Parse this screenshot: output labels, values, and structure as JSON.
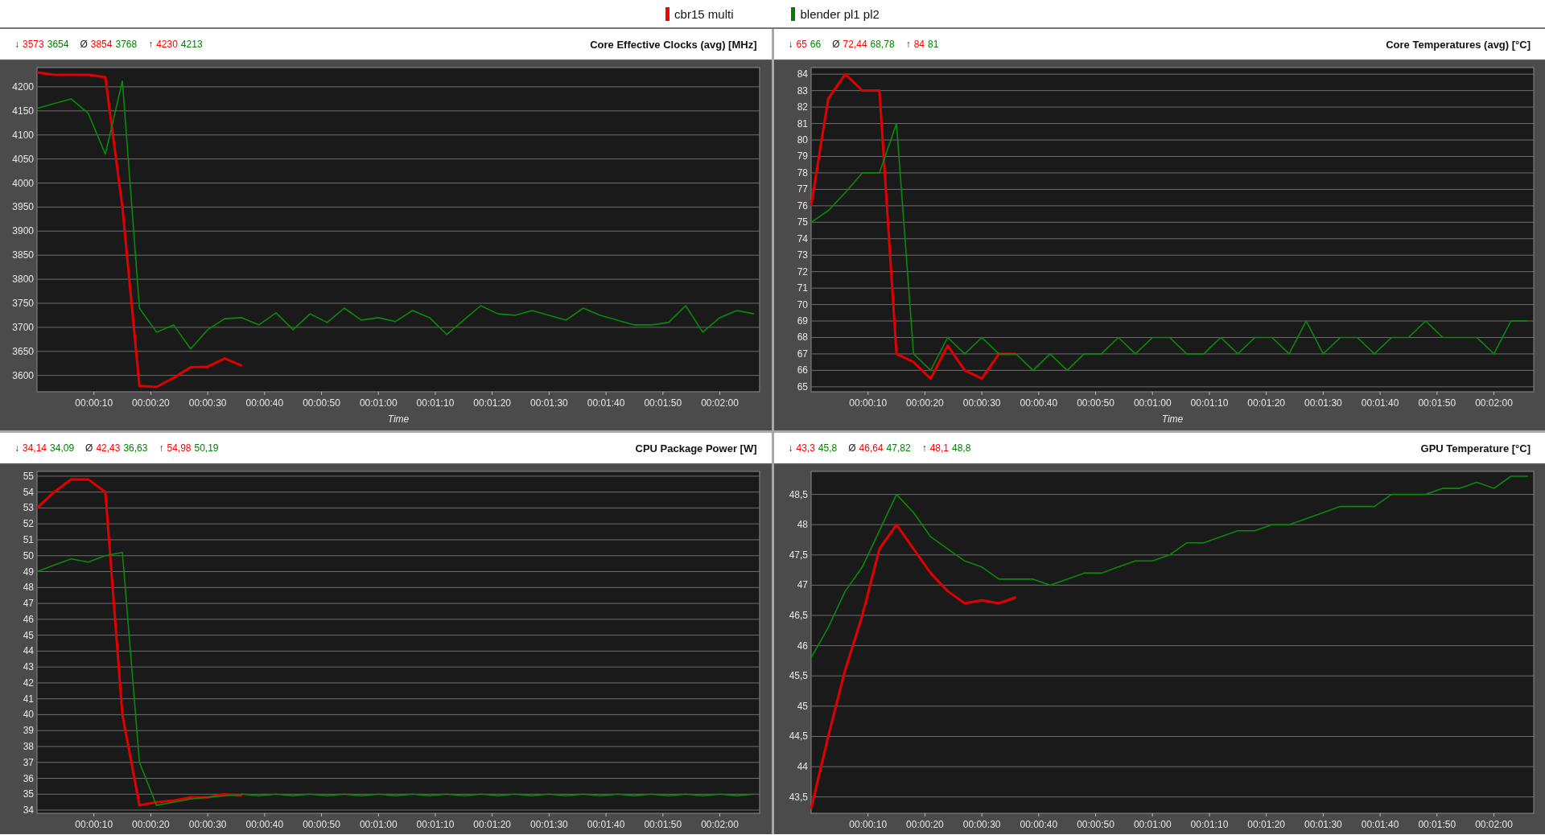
{
  "legend": [
    {
      "name": "cbr15 multi",
      "color": "#ff0000"
    },
    {
      "name": "blender pl1 pl2",
      "color": "#008000"
    }
  ],
  "panels": [
    {
      "stats": [
        {
          "symbol": "↓",
          "values": [
            "3573",
            "3654"
          ]
        },
        {
          "symbol": "Ø",
          "values": [
            "3854",
            "3768"
          ]
        },
        {
          "symbol": "↑",
          "values": [
            "4230",
            "4213"
          ]
        }
      ],
      "chart_data": {
        "type": "line",
        "title": "Core Effective Clocks (avg) [MHz]",
        "xlabel": "Time",
        "x": [
          0,
          3,
          6,
          9,
          12,
          15,
          18,
          21,
          24,
          27,
          30,
          33,
          36,
          39,
          42,
          45,
          48,
          51,
          54,
          57,
          60,
          63,
          66,
          69,
          72,
          75,
          78,
          81,
          84,
          87,
          90,
          93,
          96,
          99,
          102,
          105,
          108,
          111,
          114,
          117,
          120,
          123,
          126
        ],
        "xlim": [
          0,
          127
        ],
        "ylim": [
          3566,
          4240
        ],
        "xticks": [
          {
            "value": 10,
            "label": "00:00:10"
          },
          {
            "value": 20,
            "label": "00:00:20"
          },
          {
            "value": 30,
            "label": "00:00:30"
          },
          {
            "value": 40,
            "label": "00:00:40"
          },
          {
            "value": 50,
            "label": "00:00:50"
          },
          {
            "value": 60,
            "label": "00:01:00"
          },
          {
            "value": 70,
            "label": "00:01:10"
          },
          {
            "value": 80,
            "label": "00:01:20"
          },
          {
            "value": 90,
            "label": "00:01:30"
          },
          {
            "value": 100,
            "label": "00:01:40"
          },
          {
            "value": 110,
            "label": "00:01:50"
          },
          {
            "value": 120,
            "label": "00:02:00"
          }
        ],
        "yticks": [
          3600,
          3650,
          3700,
          3750,
          3800,
          3850,
          3900,
          3950,
          4000,
          4050,
          4100,
          4150,
          4200
        ],
        "grid": true,
        "series": [
          {
            "color": "#e00000",
            "values": [
              4230,
              4225,
              4225,
              4225,
              4220,
              3950,
              3578,
              3576,
              3595,
              3617,
              3618,
              3635,
              3620,
              null,
              null,
              null,
              null,
              null,
              null,
              null,
              null,
              null,
              null,
              null,
              null,
              null,
              null,
              null,
              null,
              null,
              null,
              null,
              null,
              null,
              null,
              null,
              null,
              null,
              null,
              null,
              null,
              null,
              null
            ]
          },
          {
            "color": "#0a8a0a",
            "values": [
              4155,
              4165,
              4175,
              4145,
              4060,
              4212,
              3740,
              3690,
              3705,
              3655,
              3695,
              3718,
              3720,
              3705,
              3730,
              3695,
              3728,
              3710,
              3740,
              3715,
              3720,
              3712,
              3735,
              3720,
              3685,
              3715,
              3745,
              3728,
              3725,
              3735,
              3725,
              3715,
              3740,
              3725,
              3715,
              3705,
              3705,
              3710,
              3745,
              3690,
              3720,
              3735,
              3728
            ]
          }
        ]
      }
    },
    {
      "stats": [
        {
          "symbol": "↓",
          "values": [
            "65",
            "66"
          ]
        },
        {
          "symbol": "Ø",
          "values": [
            "72,44",
            "68,78"
          ]
        },
        {
          "symbol": "↑",
          "values": [
            "84",
            "81"
          ]
        }
      ],
      "chart_data": {
        "type": "line",
        "title": "Core Temperatures (avg) [°C]",
        "xlabel": "Time",
        "x": [
          0,
          3,
          6,
          9,
          12,
          15,
          18,
          21,
          24,
          27,
          30,
          33,
          36,
          39,
          42,
          45,
          48,
          51,
          54,
          57,
          60,
          63,
          66,
          69,
          72,
          75,
          78,
          81,
          84,
          87,
          90,
          93,
          96,
          99,
          102,
          105,
          108,
          111,
          114,
          117,
          120,
          123,
          126
        ],
        "xlim": [
          0,
          127
        ],
        "ylim": [
          64.7,
          84.4
        ],
        "xticks": [
          {
            "value": 10,
            "label": "00:00:10"
          },
          {
            "value": 20,
            "label": "00:00:20"
          },
          {
            "value": 30,
            "label": "00:00:30"
          },
          {
            "value": 40,
            "label": "00:00:40"
          },
          {
            "value": 50,
            "label": "00:00:50"
          },
          {
            "value": 60,
            "label": "00:01:00"
          },
          {
            "value": 70,
            "label": "00:01:10"
          },
          {
            "value": 80,
            "label": "00:01:20"
          },
          {
            "value": 90,
            "label": "00:01:30"
          },
          {
            "value": 100,
            "label": "00:01:40"
          },
          {
            "value": 110,
            "label": "00:01:50"
          },
          {
            "value": 120,
            "label": "00:02:00"
          }
        ],
        "yticks": [
          65,
          66,
          67,
          68,
          69,
          70,
          71,
          72,
          73,
          74,
          75,
          76,
          77,
          78,
          79,
          80,
          81,
          82,
          83,
          84
        ],
        "grid": true,
        "series": [
          {
            "color": "#e00000",
            "values": [
              76,
              82.5,
              84,
              83,
              83,
              67,
              66.5,
              65.5,
              67.5,
              66,
              65.5,
              67,
              67,
              null,
              null,
              null,
              null,
              null,
              null,
              null,
              null,
              null,
              null,
              null,
              null,
              null,
              null,
              null,
              null,
              null,
              null,
              null,
              null,
              null,
              null,
              null,
              null,
              null,
              null,
              null,
              null,
              null,
              null
            ]
          },
          {
            "color": "#0a8a0a",
            "values": [
              75,
              75.7,
              76.8,
              78,
              78,
              81,
              67,
              66,
              68,
              67,
              68,
              67,
              67,
              66,
              67,
              66,
              67,
              67,
              68,
              67,
              68,
              68,
              67,
              67,
              68,
              67,
              68,
              68,
              67,
              69,
              67,
              68,
              68,
              67,
              68,
              68,
              69,
              68,
              68,
              68,
              67,
              69,
              69
            ]
          }
        ]
      }
    },
    {
      "stats": [
        {
          "symbol": "↓",
          "values": [
            "34,14",
            "34,09"
          ]
        },
        {
          "symbol": "Ø",
          "values": [
            "42,43",
            "36,63"
          ]
        },
        {
          "symbol": "↑",
          "values": [
            "54,98",
            "50,19"
          ]
        }
      ],
      "chart_data": {
        "type": "line",
        "title": "CPU Package Power [W]",
        "x": [
          0,
          3,
          6,
          9,
          12,
          15,
          18,
          21,
          24,
          27,
          30,
          33,
          36,
          39,
          42,
          45,
          48,
          51,
          54,
          57,
          60,
          63,
          66,
          69,
          72,
          75,
          78,
          81,
          84,
          87,
          90,
          93,
          96,
          99,
          102,
          105,
          108,
          111,
          114,
          117,
          120,
          123,
          126
        ],
        "xlim": [
          0,
          127
        ],
        "ylim": [
          33.8,
          55.3
        ],
        "xticks": [
          {
            "value": 10,
            "label": "00:00:10"
          },
          {
            "value": 20,
            "label": "00:00:20"
          },
          {
            "value": 30,
            "label": "00:00:30"
          },
          {
            "value": 40,
            "label": "00:00:40"
          },
          {
            "value": 50,
            "label": "00:00:50"
          },
          {
            "value": 60,
            "label": "00:01:00"
          },
          {
            "value": 70,
            "label": "00:01:10"
          },
          {
            "value": 80,
            "label": "00:01:20"
          },
          {
            "value": 90,
            "label": "00:01:30"
          },
          {
            "value": 100,
            "label": "00:01:40"
          },
          {
            "value": 110,
            "label": "00:01:50"
          },
          {
            "value": 120,
            "label": "00:02:00"
          }
        ],
        "yticks": [
          34,
          35,
          36,
          37,
          38,
          39,
          40,
          41,
          42,
          43,
          44,
          45,
          46,
          47,
          48,
          49,
          50,
          51,
          52,
          53,
          54,
          55
        ],
        "grid": true,
        "series": [
          {
            "color": "#e00000",
            "values": [
              53,
              54,
              54.8,
              54.8,
              54,
              40,
              34.3,
              34.5,
              34.6,
              34.8,
              34.8,
              35,
              34.9,
              null,
              null,
              null,
              null,
              null,
              null,
              null,
              null,
              null,
              null,
              null,
              null,
              null,
              null,
              null,
              null,
              null,
              null,
              null,
              null,
              null,
              null,
              null,
              null,
              null,
              null,
              null,
              null,
              null,
              null
            ]
          },
          {
            "color": "#0a8a0a",
            "values": [
              49,
              49.4,
              49.8,
              49.6,
              50,
              50.2,
              37,
              34.3,
              34.5,
              34.7,
              34.8,
              34.9,
              35,
              34.9,
              35,
              34.9,
              35,
              34.9,
              35,
              34.9,
              35,
              34.9,
              35,
              34.9,
              35,
              34.9,
              35,
              34.9,
              35,
              34.9,
              35,
              34.9,
              35,
              34.9,
              35,
              34.9,
              35,
              34.9,
              35,
              34.9,
              35,
              34.9,
              35
            ]
          }
        ]
      }
    },
    {
      "stats": [
        {
          "symbol": "↓",
          "values": [
            "43,3",
            "45,8"
          ]
        },
        {
          "symbol": "Ø",
          "values": [
            "46,64",
            "47,82"
          ]
        },
        {
          "symbol": "↑",
          "values": [
            "48,1",
            "48,8"
          ]
        }
      ],
      "chart_data": {
        "type": "line",
        "title": "GPU Temperature [°C]",
        "x": [
          0,
          3,
          6,
          9,
          12,
          15,
          18,
          21,
          24,
          27,
          30,
          33,
          36,
          39,
          42,
          45,
          48,
          51,
          54,
          57,
          60,
          63,
          66,
          69,
          72,
          75,
          78,
          81,
          84,
          87,
          90,
          93,
          96,
          99,
          102,
          105,
          108,
          111,
          114,
          117,
          120,
          123,
          126
        ],
        "xlim": [
          0,
          127
        ],
        "ylim": [
          43.23,
          48.88
        ],
        "xticks": [
          {
            "value": 10,
            "label": "00:00:10"
          },
          {
            "value": 20,
            "label": "00:00:20"
          },
          {
            "value": 30,
            "label": "00:00:30"
          },
          {
            "value": 40,
            "label": "00:00:40"
          },
          {
            "value": 50,
            "label": "00:00:50"
          },
          {
            "value": 60,
            "label": "00:01:00"
          },
          {
            "value": 70,
            "label": "00:01:10"
          },
          {
            "value": 80,
            "label": "00:01:20"
          },
          {
            "value": 90,
            "label": "00:01:30"
          },
          {
            "value": 100,
            "label": "00:01:40"
          },
          {
            "value": 110,
            "label": "00:01:50"
          },
          {
            "value": 120,
            "label": "00:02:00"
          }
        ],
        "yticks": [
          {
            "value": 43.5,
            "label": "43,5"
          },
          44,
          {
            "value": 44.5,
            "label": "44,5"
          },
          45,
          {
            "value": 45.5,
            "label": "45,5"
          },
          46,
          {
            "value": 46.5,
            "label": "46,5"
          },
          47,
          {
            "value": 47.5,
            "label": "47,5"
          },
          48,
          {
            "value": 48.5,
            "label": "48,5"
          }
        ],
        "grid": true,
        "series": [
          {
            "color": "#e00000",
            "values": [
              43.3,
              44.5,
              45.6,
              46.5,
              47.6,
              48.0,
              47.6,
              47.2,
              46.9,
              46.7,
              46.75,
              46.7,
              46.8,
              null,
              null,
              null,
              null,
              null,
              null,
              null,
              null,
              null,
              null,
              null,
              null,
              null,
              null,
              null,
              null,
              null,
              null,
              null,
              null,
              null,
              null,
              null,
              null,
              null,
              null,
              null,
              null,
              null,
              null
            ]
          },
          {
            "color": "#0a8a0a",
            "values": [
              45.8,
              46.3,
              46.9,
              47.3,
              47.9,
              48.5,
              48.2,
              47.8,
              47.6,
              47.4,
              47.3,
              47.1,
              47.1,
              47.1,
              47.0,
              47.1,
              47.2,
              47.2,
              47.3,
              47.4,
              47.4,
              47.5,
              47.7,
              47.7,
              47.8,
              47.9,
              47.9,
              48.0,
              48.0,
              48.1,
              48.2,
              48.3,
              48.3,
              48.3,
              48.5,
              48.5,
              48.5,
              48.6,
              48.6,
              48.7,
              48.6,
              48.8,
              48.8
            ]
          }
        ]
      }
    }
  ]
}
